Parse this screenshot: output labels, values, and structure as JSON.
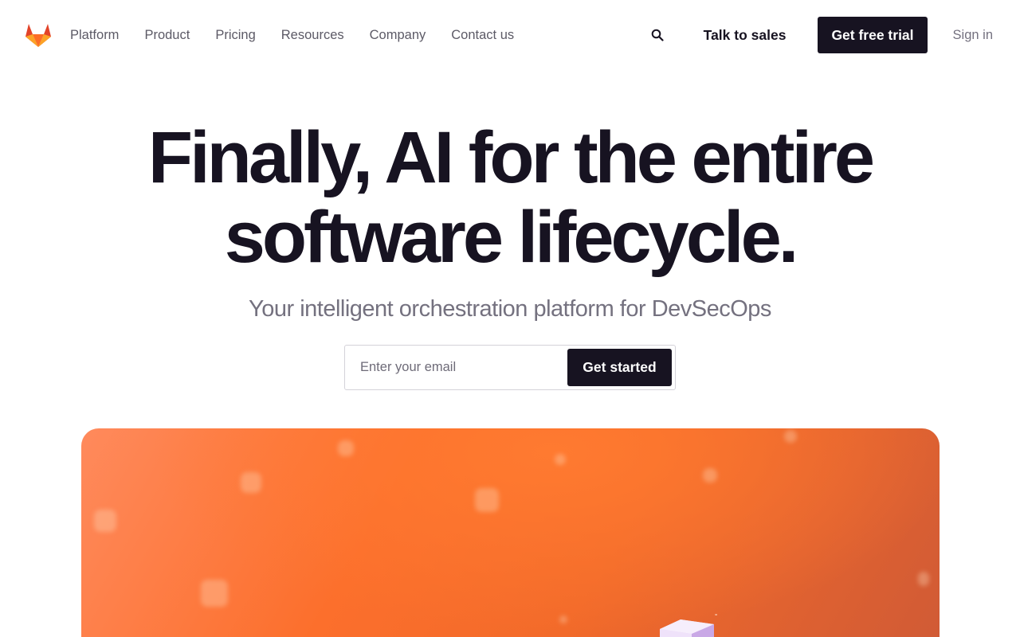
{
  "nav": {
    "logo_icon": "gitlab-tanuki-icon",
    "links": [
      "Platform",
      "Product",
      "Pricing",
      "Resources",
      "Company",
      "Contact us"
    ],
    "search_icon": "search-icon",
    "talk_to_sales": "Talk to sales",
    "free_trial": "Get free trial",
    "sign_in": "Sign in"
  },
  "hero": {
    "title_line1": "Finally, AI for the entire",
    "title_line2": "software lifecycle.",
    "subtitle": "Your intelligent orchestration platform for DevSecOps",
    "email_placeholder": "Enter your email",
    "cta": "Get started"
  },
  "colors": {
    "brand_dark": "#171321",
    "brand_orange": "#fc6d26",
    "muted_text": "#74717f"
  }
}
